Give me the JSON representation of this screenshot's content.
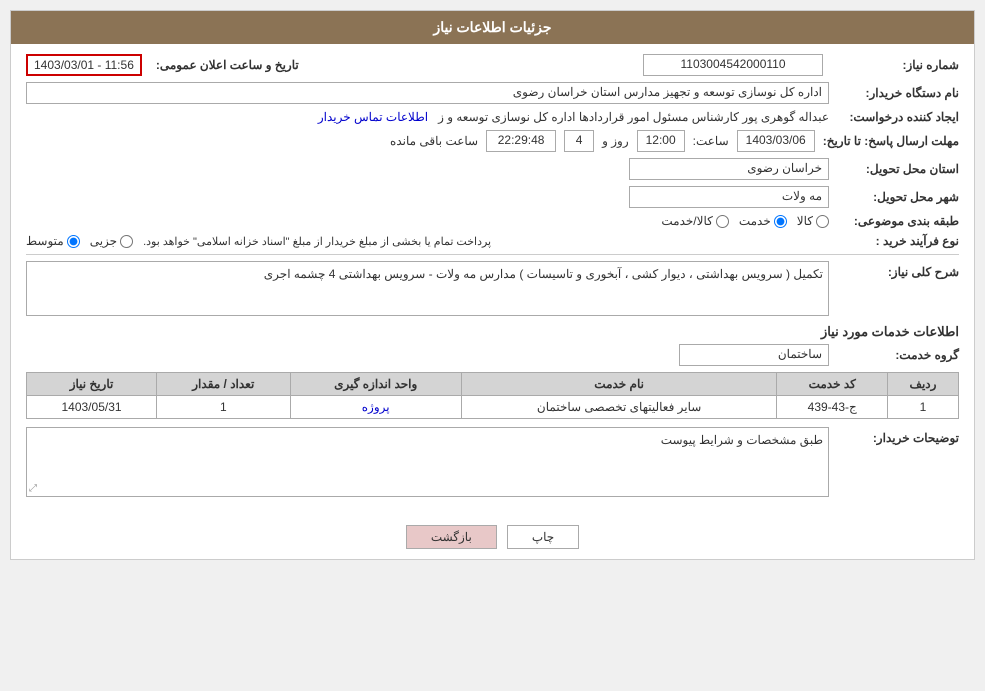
{
  "header": {
    "title": "جزئیات اطلاعات نیاز"
  },
  "fields": {
    "shomara_niaz_label": "شماره نیاز:",
    "shomara_niaz_value": "1103004542000110",
    "name_dastgah_label": "نام دستگاه خریدار:",
    "name_dastgah_value": "اداره کل نوسازی  توسعه و تجهیز مدارس استان خراسان رضوی",
    "ejad_konande_label": "ایجاد کننده درخواست:",
    "ejad_konande_value": "عبداله گوهری پور کارشناس مسئول امور قراردادها  اداره کل نوسازی  توسعه و ز",
    "ettelaat_tamas_link": "اطلاعات تماس خریدار",
    "mohlat_label": "مهلت ارسال پاسخ: تا تاریخ:",
    "mohlat_date": "1403/03/06",
    "mohlat_time_label": "ساعت:",
    "mohlat_time": "12:00",
    "mohlat_rooz_label": "روز و",
    "mohlat_rooz_value": "4",
    "mohlat_remaining_label": "ساعت باقی مانده",
    "mohlat_remaining_time": "22:29:48",
    "ostan_label": "استان محل تحویل:",
    "ostan_value": "خراسان رضوی",
    "shahr_label": "شهر محل تحویل:",
    "shahr_value": "مه ولات",
    "tabaqe_label": "طبقه بندی موضوعی:",
    "tabaqe_options": [
      "کالا",
      "خدمت",
      "کالا/خدمت"
    ],
    "tabaqe_selected": "خدمت",
    "nooe_farayand_label": "نوع فرآیند خرید :",
    "nooe_farayand_options": [
      "جزیی",
      "متوسط"
    ],
    "nooe_farayand_selected": "متوسط",
    "nooe_farayand_note": "پرداخت تمام یا بخشی از مبلغ خریدار از مبلغ \"اسناد خزانه اسلامی\" خواهد بود.",
    "sharh_label": "شرح کلی نیاز:",
    "sharh_value": "تکمیل ( سرویس بهداشتی ، دیوار کشی ، آبخوری و تاسیسات ) مدارس مه ولات - سرویس بهداشتی 4 چشمه اجری",
    "khadamat_label": "اطلاعات خدمات مورد نیاز",
    "gorooh_khedmat_label": "گروه خدمت:",
    "gorooh_khedmat_value": "ساختمان",
    "table": {
      "headers": [
        "ردیف",
        "کد خدمت",
        "نام خدمت",
        "واحد اندازه گیری",
        "تعداد / مقدار",
        "تاریخ نیاز"
      ],
      "rows": [
        {
          "radif": "1",
          "code": "ج-43-439",
          "name": "سایر فعالیتهای تخصصی ساختمان",
          "unit": "پروژه",
          "quantity": "1",
          "date": "1403/05/31"
        }
      ]
    },
    "tawsif_label": "توضیحات خریدار:",
    "tawsif_value": "طبق مشخصات و شرایط پیوست",
    "date_announce_label": "تاریخ و ساعت اعلان عمومی:",
    "date_announce_value": "1403/03/01 - 11:56"
  },
  "buttons": {
    "print": "چاپ",
    "back": "بازگشت"
  }
}
